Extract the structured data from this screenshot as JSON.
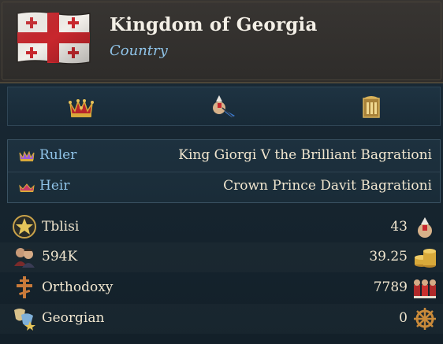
{
  "header": {
    "title": "Kingdom of Georgia",
    "subtitle": "Country",
    "flag_icon": "georgia-five-cross-flag"
  },
  "tabs": [
    {
      "icon": "crown-icon"
    },
    {
      "icon": "diplomat-icon"
    },
    {
      "icon": "government-icon"
    }
  ],
  "rulers": [
    {
      "icon": "ruler-crown-icon",
      "label": "Ruler",
      "value": "King Giorgi V the Brilliant Bagrationi"
    },
    {
      "icon": "heir-coronet-icon",
      "label": "Heir",
      "value": "Crown Prince Davit Bagrationi"
    }
  ],
  "stats": [
    {
      "left_icon": "capital-star-icon",
      "label": "Tblisi",
      "value": "43",
      "right_icon": "diplomat-icon"
    },
    {
      "left_icon": "population-icon",
      "label": "594K",
      "value": "39.25",
      "right_icon": "gold-coins-icon"
    },
    {
      "left_icon": "orthodox-cross-icon",
      "label": "Orthodoxy",
      "value": "7789",
      "right_icon": "army-icon"
    },
    {
      "left_icon": "culture-masks-icon",
      "label": "Georgian",
      "value": "0",
      "right_icon": "ship-wheel-icon"
    }
  ],
  "colors": {
    "title": "#f3efe6",
    "subtitle": "#8fc3e8",
    "label_blue": "#8fc3e8",
    "value_text": "#f0e6cf",
    "flag_red": "#c8272d",
    "gold": "#d8a93a"
  }
}
